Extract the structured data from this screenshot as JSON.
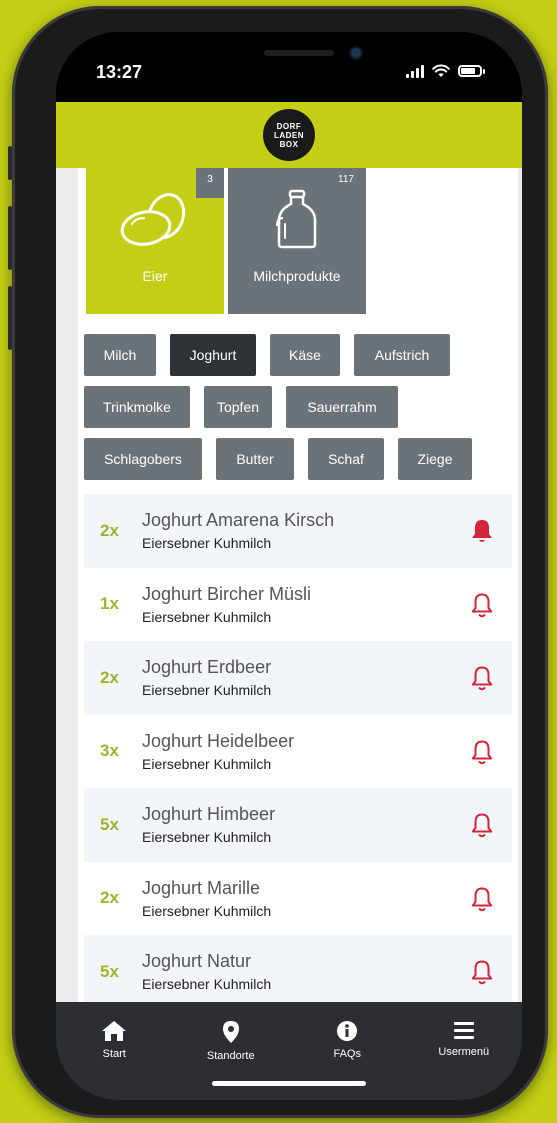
{
  "status": {
    "time": "13:27"
  },
  "logo": {
    "line1": "DORF",
    "line2": "LADEN",
    "line3": "BOX"
  },
  "tiles": [
    {
      "label": "Eier",
      "count": "3",
      "active": true,
      "icon": "eggs-icon"
    },
    {
      "label": "Milchprodukte",
      "count": "117",
      "active": false,
      "icon": "milk-can-icon"
    }
  ],
  "chips": [
    [
      "Milch",
      "Joghurt",
      "Käse",
      "Aufstrich"
    ],
    [
      "Trinkmolke",
      "Topfen",
      "Sauerrahm"
    ],
    [
      "Schlagobers",
      "Butter",
      "Schaf",
      "Ziege"
    ]
  ],
  "selected_chip": "Joghurt",
  "products": [
    {
      "qty": "2x",
      "name": "Joghurt Amarena Kirsch",
      "sub": "Eiersebner Kuhmilch",
      "bell_filled": true
    },
    {
      "qty": "1x",
      "name": "Joghurt Bircher Müsli",
      "sub": "Eiersebner Kuhmilch",
      "bell_filled": false
    },
    {
      "qty": "2x",
      "name": "Joghurt Erdbeer",
      "sub": "Eiersebner Kuhmilch",
      "bell_filled": false
    },
    {
      "qty": "3x",
      "name": "Joghurt Heidelbeer",
      "sub": "Eiersebner Kuhmilch",
      "bell_filled": false
    },
    {
      "qty": "5x",
      "name": "Joghurt Himbeer",
      "sub": "Eiersebner Kuhmilch",
      "bell_filled": false
    },
    {
      "qty": "2x",
      "name": "Joghurt Marille",
      "sub": "Eiersebner Kuhmilch",
      "bell_filled": false
    },
    {
      "qty": "5x",
      "name": "Joghurt Natur",
      "sub": "Eiersebner Kuhmilch",
      "bell_filled": false
    }
  ],
  "tabbar": [
    {
      "label": "Start",
      "icon": "home-icon"
    },
    {
      "label": "Standorte",
      "icon": "location-pin-icon"
    },
    {
      "label": "FAQs",
      "icon": "info-icon"
    },
    {
      "label": "Usermenü",
      "icon": "menu-icon"
    }
  ],
  "colors": {
    "brand": "#c3cf14",
    "chip": "#6b7278",
    "chip_selected": "#2e3338",
    "qty": "#9ab52d",
    "bell": "#d0253a"
  }
}
